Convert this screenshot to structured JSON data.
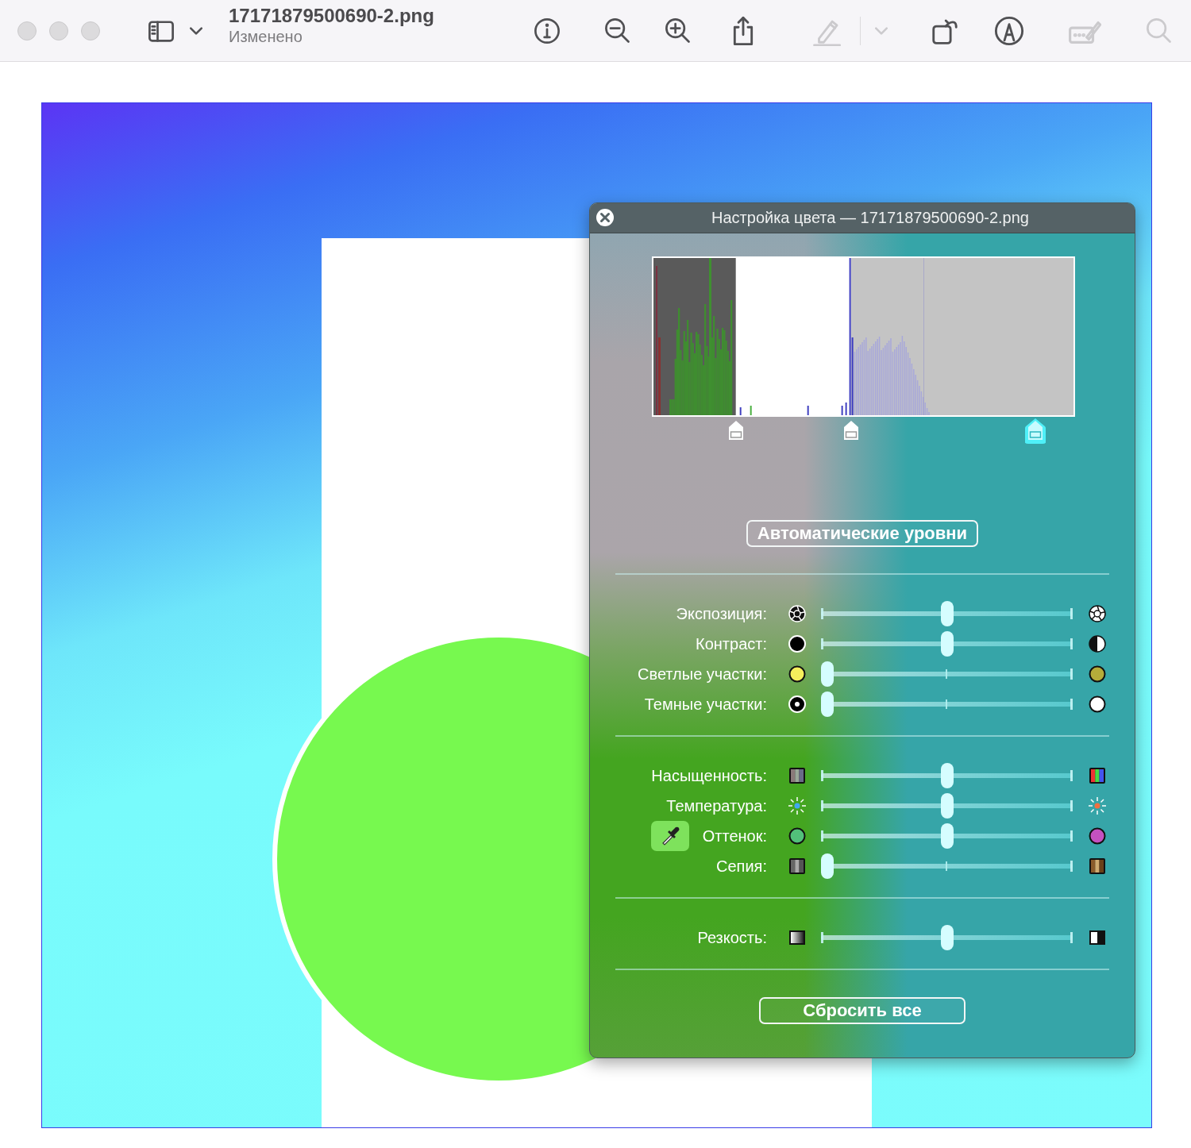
{
  "window": {
    "title": "17171879500690-2.png",
    "subtitle": "Изменено"
  },
  "toolbar_buttons": [
    {
      "disabled": false
    },
    {
      "disabled": false
    },
    {
      "disabled": false
    },
    {
      "disabled": false
    },
    {
      "disabled": false
    },
    {
      "disabled": false
    },
    {
      "disabled": true
    },
    {
      "disabled": true
    },
    {
      "disabled": false
    },
    {
      "disabled": false
    },
    {
      "disabled": true
    },
    {
      "disabled": true
    }
  ],
  "color_panel": {
    "title": "Настройка цвета — 17171879500690-2.png",
    "level_handles": [
      {
        "level": 0.196,
        "selected": false
      },
      {
        "level": 0.47,
        "selected": false
      },
      {
        "level": 0.91,
        "selected": true
      }
    ],
    "auto_levels_button": "Автоматические уровни",
    "groups": [
      {
        "sliders": [
          {
            "label": "Экспозиция:",
            "level": 0.5,
            "eyedropper": false
          },
          {
            "label": "Контраст:",
            "level": 0.5,
            "eyedropper": false
          },
          {
            "label": "Светлые участки:",
            "level": 0,
            "eyedropper": false
          },
          {
            "label": "Темные участки:",
            "level": 0,
            "eyedropper": false
          }
        ]
      },
      {
        "sliders": [
          {
            "label": "Насыщенность:",
            "level": 0.5,
            "eyedropper": false
          },
          {
            "label": "Температура:",
            "level": 0.5,
            "eyedropper": false
          },
          {
            "label": "Оттенок:",
            "level": 0.5,
            "eyedropper": true
          },
          {
            "label": "Сепия:",
            "level": 0,
            "eyedropper": false
          }
        ]
      },
      {
        "sliders": [
          {
            "label": "Резкость:",
            "level": 0.5,
            "eyedropper": false
          }
        ]
      }
    ],
    "reset_button": "Сбросить все"
  }
}
